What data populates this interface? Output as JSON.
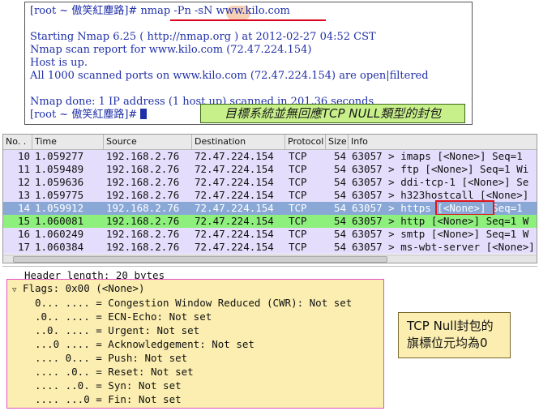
{
  "terminal": {
    "prompt": "[root ~ 傲笑紅塵路]#",
    "command": "nmap -Pn -sN www.kilo.com",
    "lines": [
      "Starting Nmap 6.25 ( http://nmap.org ) at 2012-02-27 04:52 CST",
      "Nmap scan report for www.kilo.com (72.47.224.154)",
      "Host is up.",
      "All 1000 scanned ports on www.kilo.com (72.47.224.154) are open|filtered",
      "Nmap done: 1 IP address (1 host up) scanned in 201.36 seconds"
    ],
    "prompt2": "[root ~ 傲笑紅塵路]#",
    "annotation": "目標系統並無回應TCP NULL類型的封包"
  },
  "packet_list": {
    "columns": [
      "No. .",
      "Time",
      "Source",
      "Destination",
      "Protocol",
      "Size",
      "Info"
    ],
    "rows": [
      {
        "no": "10",
        "time": "1.059277",
        "src": "192.168.2.76",
        "dst": "72.47.224.154",
        "proto": "TCP",
        "size": "54",
        "info": "63057 > imaps [<None>] Seq=1"
      },
      {
        "no": "11",
        "time": "1.059489",
        "src": "192.168.2.76",
        "dst": "72.47.224.154",
        "proto": "TCP",
        "size": "54",
        "info": "63057 > ftp [<None>] Seq=1 Wi"
      },
      {
        "no": "12",
        "time": "1.059636",
        "src": "192.168.2.76",
        "dst": "72.47.224.154",
        "proto": "TCP",
        "size": "54",
        "info": "63057 > ddi-tcp-1 [<None>] Se"
      },
      {
        "no": "13",
        "time": "1.059775",
        "src": "192.168.2.76",
        "dst": "72.47.224.154",
        "proto": "TCP",
        "size": "54",
        "info": "63057 > h323hostcall [<None>]"
      },
      {
        "no": "14",
        "time": "1.059912",
        "src": "192.168.2.76",
        "dst": "72.47.224.154",
        "proto": "TCP",
        "size": "54",
        "info": "63057 > https [<None>] Seq=1"
      },
      {
        "no": "15",
        "time": "1.060081",
        "src": "192.168.2.76",
        "dst": "72.47.224.154",
        "proto": "TCP",
        "size": "54",
        "info": "63057 > http [<None>] Seq=1 W"
      },
      {
        "no": "16",
        "time": "1.060249",
        "src": "192.168.2.76",
        "dst": "72.47.224.154",
        "proto": "TCP",
        "size": "54",
        "info": "63057 > smtp [<None>] Seq=1 W"
      },
      {
        "no": "17",
        "time": "1.060384",
        "src": "192.168.2.76",
        "dst": "72.47.224.154",
        "proto": "TCP",
        "size": "54",
        "info": "63057 > ms-wbt-server [<None>]"
      }
    ]
  },
  "details": {
    "header_length": "Header length: 20 bytes",
    "flags_title": "Flags: 0x00 (<None>)",
    "flags": [
      "0... .... = Congestion Window Reduced (CWR): Not set",
      ".0.. .... = ECN-Echo: Not set",
      "..0. .... = Urgent: Not set",
      "...0 .... = Acknowledgement: Not set",
      ".... 0... = Push: Not set",
      ".... .0.. = Reset: Not set",
      ".... ..0. = Syn: Not set",
      ".... ...0 = Fin: Not set"
    ],
    "annotation_line1": "TCP Null封包的",
    "annotation_line2": "旗標位元均為0"
  },
  "colors": {
    "terminal_text": "#1f2fa8",
    "row_normal": "#e4ddfb",
    "row_selected": "#8aa8d6",
    "row_http": "#8df07c",
    "highlight_red": "#e0141e"
  }
}
